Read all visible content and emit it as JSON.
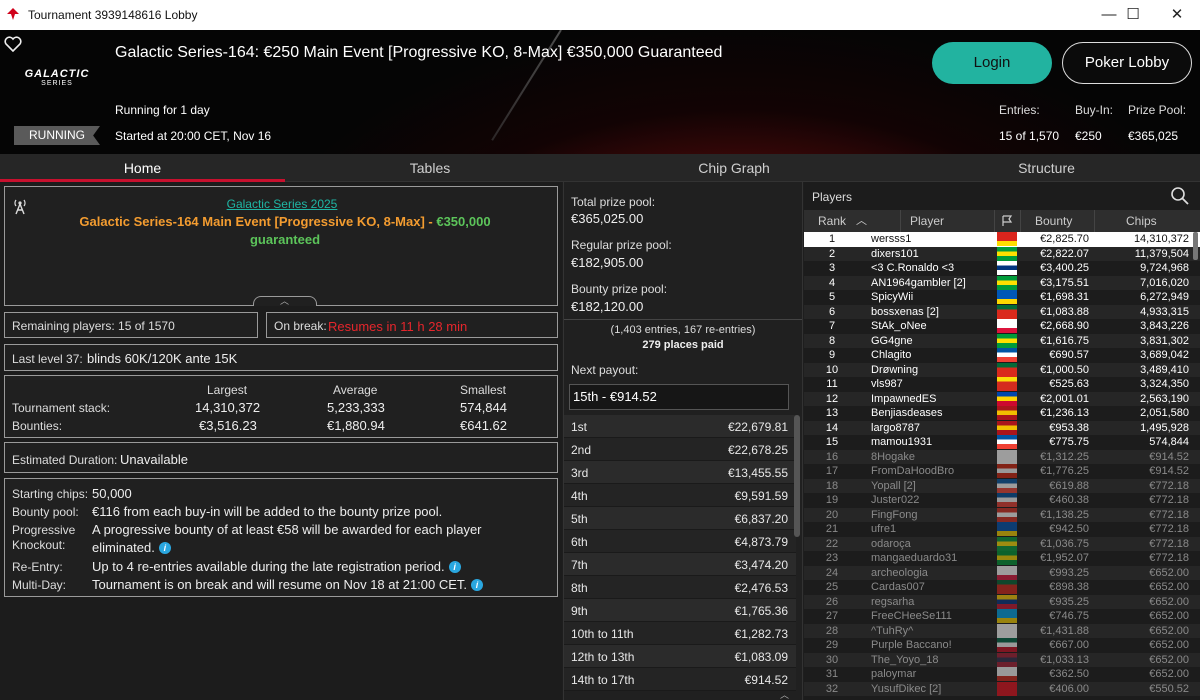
{
  "window": {
    "title": "Tournament 3939148616 Lobby",
    "minimize": "—",
    "maximize": "☐",
    "close": "✕"
  },
  "header": {
    "event_title": "Galactic Series-164: €250 Main Event [Progressive KO, 8-Max] €350,000 Guaranteed",
    "logo_line1": "GALACTIC",
    "logo_line2": "SERIES",
    "running_for": "Running for 1 day",
    "started": "Started at 20:00 CET, Nov 16",
    "status": "RUNNING",
    "login_label": "Login",
    "poker_lobby_label": "Poker Lobby",
    "entries_label": "Entries:",
    "entries_value": "15 of 1,570",
    "buyin_label": "Buy-In:",
    "buyin_value": "€250",
    "prizepool_label": "Prize Pool:",
    "prizepool_value": "€365,025"
  },
  "tabs": [
    "Home",
    "Tables",
    "Chip Graph",
    "Structure"
  ],
  "home": {
    "series_link": "Galactic Series 2025",
    "event_name": "Galactic Series-164 Main Event [Progressive KO, 8-Max]",
    "event_sep": " - ",
    "guarantee": "€350,000 guaranteed",
    "remaining": "Remaining players: 15 of 1570",
    "on_break_label": "On break:",
    "on_break_value": "Resumes in 11 h 28 min",
    "last_level_label": "Last level 37:",
    "last_level_value": "blinds 60K/120K ante 15K",
    "stats": {
      "col_largest": "Largest",
      "col_average": "Average",
      "col_smallest": "Smallest",
      "row_stack": "Tournament stack:",
      "row_bounties": "Bounties:",
      "stack_largest": "14,310,372",
      "stack_average": "5,233,333",
      "stack_smallest": "574,844",
      "bounty_largest": "€3,516.23",
      "bounty_average": "€1,880.94",
      "bounty_smallest": "€641.62"
    },
    "est_duration_label": "Estimated Duration:",
    "est_duration_value": "Unavailable",
    "info": {
      "starting_chips_label": "Starting chips:",
      "starting_chips_value": "50,000",
      "bounty_pool_label": "Bounty pool:",
      "bounty_pool_value": "€116 from each buy-in will be added to the bounty prize pool.",
      "pko_label1": "Progressive",
      "pko_label2": "Knockout:",
      "pko_value1": "A progressive bounty of at least €58 will be awarded for each player",
      "pko_value2": "eliminated.",
      "reentry_label": "Re-Entry:",
      "reentry_value": "Up to 4 re-entries available during the late registration period.",
      "multiday_label": "Multi-Day:",
      "multiday_value": "Tournament is on break and will resume on Nov 18 at 21:00 CET."
    }
  },
  "prizes": {
    "total_label": "Total prize pool:",
    "total_value": "€365,025.00",
    "regular_label": "Regular prize pool:",
    "regular_value": "€182,905.00",
    "bounty_label": "Bounty prize pool:",
    "bounty_value": "€182,120.00",
    "entries_note": "(1,403 entries, 167 re-entries)",
    "places_paid": "279 places paid",
    "next_payout_label": "Next payout:",
    "next_payout_value": "15th - €914.52",
    "payouts": [
      {
        "place": "1st",
        "amount": "€22,679.81"
      },
      {
        "place": "2nd",
        "amount": "€22,678.25"
      },
      {
        "place": "3rd",
        "amount": "€13,455.55"
      },
      {
        "place": "4th",
        "amount": "€9,591.59"
      },
      {
        "place": "5th",
        "amount": "€6,837.20"
      },
      {
        "place": "6th",
        "amount": "€4,873.79"
      },
      {
        "place": "7th",
        "amount": "€3,474.20"
      },
      {
        "place": "8th",
        "amount": "€2,476.53"
      },
      {
        "place": "9th",
        "amount": "€1,765.36"
      },
      {
        "place": "10th to 11th",
        "amount": "€1,282.73"
      },
      {
        "place": "12th to 13th",
        "amount": "€1,083.09"
      },
      {
        "place": "14th to 17th",
        "amount": "€914.52"
      }
    ]
  },
  "players": {
    "title": "Players",
    "col_rank": "Rank",
    "col_player": "Player",
    "col_bounty": "Bounty",
    "col_chips": "Chips",
    "rows": [
      {
        "rank": "1",
        "name": "wersss1",
        "bounty": "€2,825.70",
        "chips": "14,310,372",
        "flag": [
          "#da251d",
          "#da251d",
          "#ffde00"
        ]
      },
      {
        "rank": "2",
        "name": "dixers101",
        "bounty": "€2,822.07",
        "chips": "11,379,504",
        "flag": [
          "#009b3a",
          "#fedf00",
          "#009b3a"
        ]
      },
      {
        "rank": "3",
        "name": "<3 C.Ronaldo <3",
        "bounty": "€3,400.25",
        "chips": "9,724,968",
        "flag": [
          "#ffffff",
          "#003580",
          "#ffffff"
        ]
      },
      {
        "rank": "4",
        "name": "AN1964gambler [2]",
        "bounty": "€3,175.51",
        "chips": "7,016,020",
        "flag": [
          "#009b3a",
          "#fedf00",
          "#009b3a"
        ]
      },
      {
        "rank": "5",
        "name": "SpicyWii",
        "bounty": "€1,698.31",
        "chips": "6,272,949",
        "flag": [
          "#0057b7",
          "#0057b7",
          "#ffd700"
        ]
      },
      {
        "rank": "6",
        "name": "bossxenas [2]",
        "bounty": "€1,083.88",
        "chips": "4,933,315",
        "flag": [
          "#046a38",
          "#da291c",
          "#da291c"
        ]
      },
      {
        "rank": "7",
        "name": "StAk_oNee",
        "bounty": "€2,668.90",
        "chips": "3,843,226",
        "flag": [
          "#ffffff",
          "#ffffff",
          "#dc143c"
        ]
      },
      {
        "rank": "8",
        "name": "GG4gne",
        "bounty": "€1,616.75",
        "chips": "3,831,302",
        "flag": [
          "#009b3a",
          "#fedf00",
          "#009b3a"
        ]
      },
      {
        "rank": "9",
        "name": "Chlagito",
        "bounty": "€690.57",
        "chips": "3,689,042",
        "flag": [
          "#0055a4",
          "#ffffff",
          "#ef4135"
        ]
      },
      {
        "rank": "10",
        "name": "Drøwning",
        "bounty": "€1,000.50",
        "chips": "3,489,410",
        "flag": [
          "#046a38",
          "#da291c",
          "#da291c"
        ]
      },
      {
        "rank": "11",
        "name": "vls987",
        "bounty": "€525.63",
        "chips": "3,324,350",
        "flag": [
          "#fcdd09",
          "#d52b1e",
          "#d52b1e"
        ]
      },
      {
        "rank": "12",
        "name": "ImpawnedES",
        "bounty": "€2,001.01",
        "chips": "2,563,190",
        "flag": [
          "#0046ae",
          "#ffd200",
          "#cc092f"
        ]
      },
      {
        "rank": "13",
        "name": "Benjiasdeases",
        "bounty": "€1,236.13",
        "chips": "2,051,580",
        "flag": [
          "#aa151b",
          "#f1bf00",
          "#aa151b"
        ]
      },
      {
        "rank": "14",
        "name": "largo8787",
        "bounty": "€953.38",
        "chips": "1,495,928",
        "flag": [
          "#aa151b",
          "#f1bf00",
          "#aa151b"
        ]
      },
      {
        "rank": "15",
        "name": "mamou1931",
        "bounty": "€775.75",
        "chips": "574,844",
        "flag": [
          "#0055a4",
          "#ffffff",
          "#ef4135"
        ]
      },
      {
        "rank": "16",
        "name": "8Hogake",
        "bounty": "€1,312.25",
        "chips": "€914.52",
        "flag": [
          "#ffffff",
          "#ffffff",
          "#ffffff"
        ]
      },
      {
        "rank": "17",
        "name": "FromDaHoodBro",
        "bounty": "€1,776.25",
        "chips": "€914.52",
        "flag": [
          "#d62612",
          "#ffffff",
          "#d62612"
        ]
      },
      {
        "rank": "18",
        "name": "Yopall [2]",
        "bounty": "€619.88",
        "chips": "€772.18",
        "flag": [
          "#0055a4",
          "#ffffff",
          "#ef4135"
        ]
      },
      {
        "rank": "19",
        "name": "Juster022",
        "bounty": "€460.38",
        "chips": "€772.18",
        "flag": [
          "#0055a4",
          "#ffffff",
          "#ef4135"
        ]
      },
      {
        "rank": "20",
        "name": "FingFong",
        "bounty": "€1,138.25",
        "chips": "€772.18",
        "flag": [
          "#d52b1e",
          "#ffffff",
          "#d52b1e"
        ]
      },
      {
        "rank": "21",
        "name": "ufre1",
        "bounty": "€942.50",
        "chips": "€772.18",
        "flag": [
          "#0057b7",
          "#0057b7",
          "#ffd700"
        ]
      },
      {
        "rank": "22",
        "name": "odaroça",
        "bounty": "€1,036.75",
        "chips": "€772.18",
        "flag": [
          "#009b3a",
          "#fedf00",
          "#009b3a"
        ]
      },
      {
        "rank": "23",
        "name": "mangaeduardo31",
        "bounty": "€1,952.07",
        "chips": "€772.18",
        "flag": [
          "#009b3a",
          "#fedf00",
          "#009b3a"
        ]
      },
      {
        "rank": "24",
        "name": "archeologia",
        "bounty": "€993.25",
        "chips": "€652.00",
        "flag": [
          "#ffffff",
          "#ffffff",
          "#dc143c"
        ]
      },
      {
        "rank": "25",
        "name": "Cardas007",
        "bounty": "€898.38",
        "chips": "€652.00",
        "flag": [
          "#046a38",
          "#da291c",
          "#da291c"
        ]
      },
      {
        "rank": "26",
        "name": "regsarha",
        "bounty": "€935.25",
        "chips": "€652.00",
        "flag": [
          "#ffcd00",
          "#003082",
          "#c8102e"
        ]
      },
      {
        "rank": "27",
        "name": "FreeCHeeSe111",
        "bounty": "€746.75",
        "chips": "€652.00",
        "flag": [
          "#00aaf0",
          "#00aaf0",
          "#ffd700"
        ]
      },
      {
        "rank": "28",
        "name": "^TuhRy^",
        "bounty": "€1,431.88",
        "chips": "€652.00",
        "flag": [
          "#ffffff",
          "#ffffff",
          "#ffffff"
        ]
      },
      {
        "rank": "29",
        "name": "Purple Baccano!",
        "bounty": "€667.00",
        "chips": "€652.00",
        "flag": [
          "#006847",
          "#ffffff",
          "#ce1126"
        ]
      },
      {
        "rank": "30",
        "name": "The_Yoyo_18",
        "bounty": "€1,033.13",
        "chips": "€652.00",
        "flag": [
          "#a51931",
          "#2d2a4a",
          "#a51931"
        ]
      },
      {
        "rank": "31",
        "name": "paloymar",
        "bounty": "€362.50",
        "chips": "€652.00",
        "flag": [
          "#ffffff",
          "#ffffff",
          "#d52b1e"
        ]
      },
      {
        "rank": "32",
        "name": "YusufDikec [2]",
        "bounty": "€406.00",
        "chips": "€550.52",
        "flag": [
          "#e30a17",
          "#e30a17",
          "#e30a17"
        ]
      }
    ]
  },
  "colors": {
    "accent_teal": "#22b3a0",
    "tab_underline": "#c8102e",
    "orange": "#f39c30",
    "green": "#5cc45a",
    "red_text": "#e5262c",
    "info_blue": "#2aa7e0"
  },
  "icons": [
    "pokerstars-spade-icon",
    "heart-icon",
    "antenna-icon",
    "search-icon",
    "flag-icon",
    "sort-up-icon",
    "chevron-up-icon",
    "info-icon"
  ]
}
